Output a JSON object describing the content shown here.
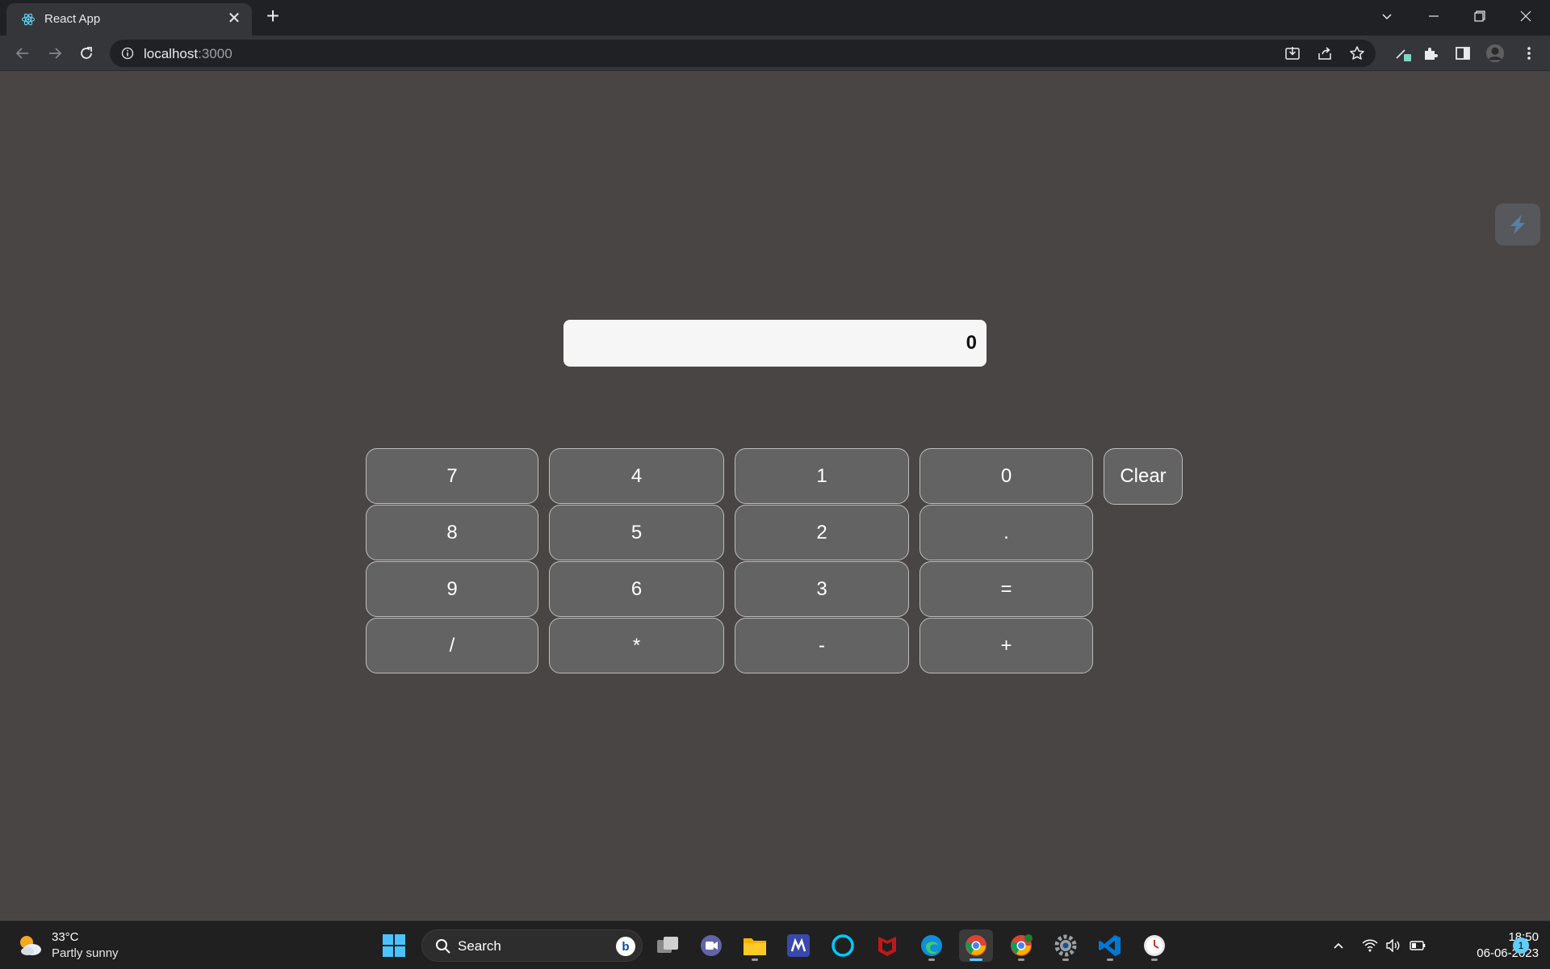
{
  "browser": {
    "tab_title": "React App",
    "tab_close": "✕",
    "new_tab": "+",
    "url_host": "localhost",
    "url_port": ":3000"
  },
  "calculator": {
    "display_value": "0",
    "keys": [
      "7",
      "4",
      "1",
      "0",
      "Clear",
      "8",
      "5",
      "2",
      ".",
      "9",
      "6",
      "3",
      "=",
      "/",
      "*",
      "-",
      "+"
    ]
  },
  "taskbar": {
    "weather_temp": "33°C",
    "weather_desc": "Partly sunny",
    "search_text": "Search",
    "bing_label": "b",
    "time": "18:50",
    "date": "06-06-2023",
    "notification_count": "1"
  },
  "colors": {
    "page_background": "#4a4545",
    "key_background": "#636363",
    "display_background": "#f6f6f6",
    "accent": "#60cdff"
  }
}
